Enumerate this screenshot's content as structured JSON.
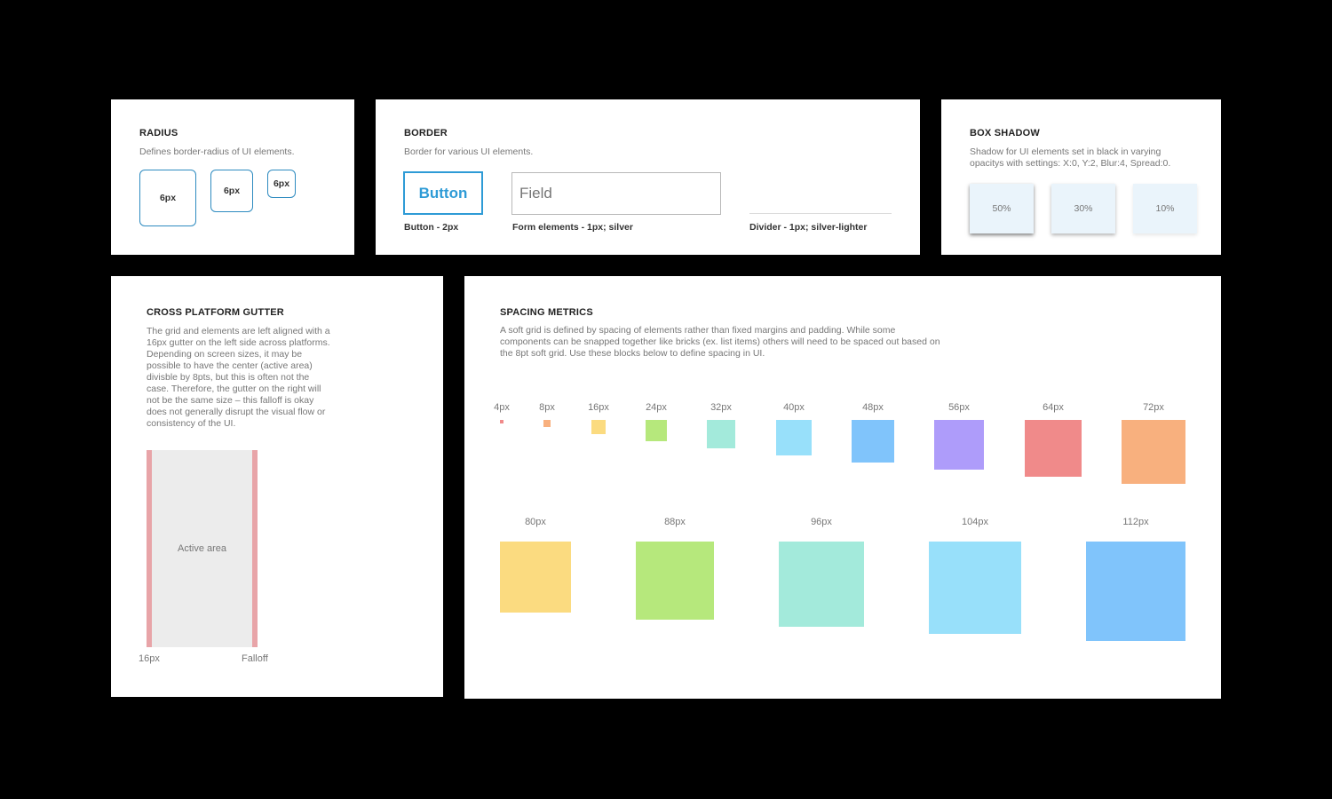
{
  "radius": {
    "title": "RADIUS",
    "description": "Defines border-radius of UI elements.",
    "samples": [
      "6px",
      "6px",
      "6px"
    ]
  },
  "border": {
    "title": "BORDER",
    "description": "Border for various UI elements.",
    "button_label": "Button",
    "field_placeholder": "Field",
    "captions": {
      "button": "Button - 2px",
      "form": "Form elements - 1px; silver",
      "divider": "Divider - 1px; silver-lighter"
    },
    "accent_color": "#2e9bd6"
  },
  "box_shadow": {
    "title": "BOX SHADOW",
    "description_line1": "Shadow for UI elements set in black in varying",
    "description_line2": "opacitys with settings: X:0, Y:2, Blur:4, Spread:0.",
    "samples": [
      {
        "label": "50%",
        "opacity": 0.5
      },
      {
        "label": "30%",
        "opacity": 0.3
      },
      {
        "label": "10%",
        "opacity": 0.1
      }
    ]
  },
  "gutter": {
    "title": "CROSS PLATFORM GUTTER",
    "description_lines": [
      "The grid and elements are left aligned with a",
      "16px gutter on the left side across platforms.",
      "Depending on screen sizes, it may be",
      "possible to have the center (active area)",
      "divisble by 8pts, but this is often not the",
      "case. Therefore, the gutter on the right will",
      "not be the same size – this falloff is okay",
      "does not generally disrupt the visual flow or",
      "consistency of the UI."
    ],
    "active_area_label": "Active area",
    "left_label": "16px",
    "right_label": "Falloff",
    "gutter_color": "#e8a4a8",
    "area_color": "#ececec"
  },
  "spacing": {
    "title": "SPACING METRICS",
    "description_lines": [
      "A soft grid is defined by spacing of elements rather than fixed margins and padding. While some",
      "components can be snapped together like bricks (ex. list items) others will need to be spaced out based on",
      "the 8pt soft grid. Use these blocks below to define spacing in UI."
    ],
    "blocks": [
      {
        "label": "4px",
        "color": "#f08a8a"
      },
      {
        "label": "8px",
        "color": "#f8b07e"
      },
      {
        "label": "16px",
        "color": "#fbdb80"
      },
      {
        "label": "24px",
        "color": "#b6e87c"
      },
      {
        "label": "32px",
        "color": "#a3eadb"
      },
      {
        "label": "40px",
        "color": "#98e0fa"
      },
      {
        "label": "48px",
        "color": "#80c4fb"
      },
      {
        "label": "56px",
        "color": "#ae9cfa"
      },
      {
        "label": "64px",
        "color": "#f08a8a"
      },
      {
        "label": "72px",
        "color": "#f8b07e"
      },
      {
        "label": "80px",
        "color": "#fbdb80"
      },
      {
        "label": "88px",
        "color": "#b6e87c"
      },
      {
        "label": "96px",
        "color": "#a3eadb"
      },
      {
        "label": "104px",
        "color": "#98e0fa"
      },
      {
        "label": "112px",
        "color": "#80c4fb"
      }
    ]
  }
}
